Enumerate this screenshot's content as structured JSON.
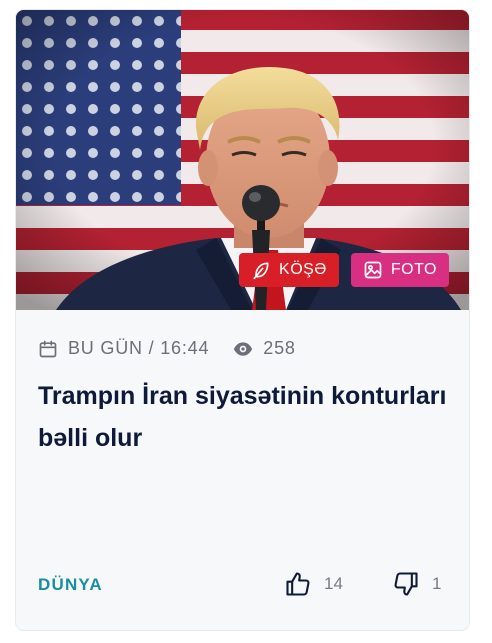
{
  "article": {
    "badges": {
      "kose_label": "KÖŞƏ",
      "foto_label": "FOTO"
    },
    "meta": {
      "date": "BU GÜN / 16:44",
      "views": "258"
    },
    "title": "Trampın İran siyasətinin konturları bəlli olur",
    "category": "DÜNYA",
    "likes": "14",
    "dislikes": "1"
  },
  "colors": {
    "kose_badge": "#d81f27",
    "foto_badge": "#d92f83",
    "title_text": "#0f1a3a",
    "category_text": "#1a8da0",
    "meta_text": "#6b6f78"
  },
  "icons": {
    "kose": "feather-icon",
    "foto": "image-icon",
    "date": "calendar-icon",
    "views": "eye-icon",
    "like": "thumbs-up-icon",
    "dislike": "thumbs-down-icon"
  }
}
